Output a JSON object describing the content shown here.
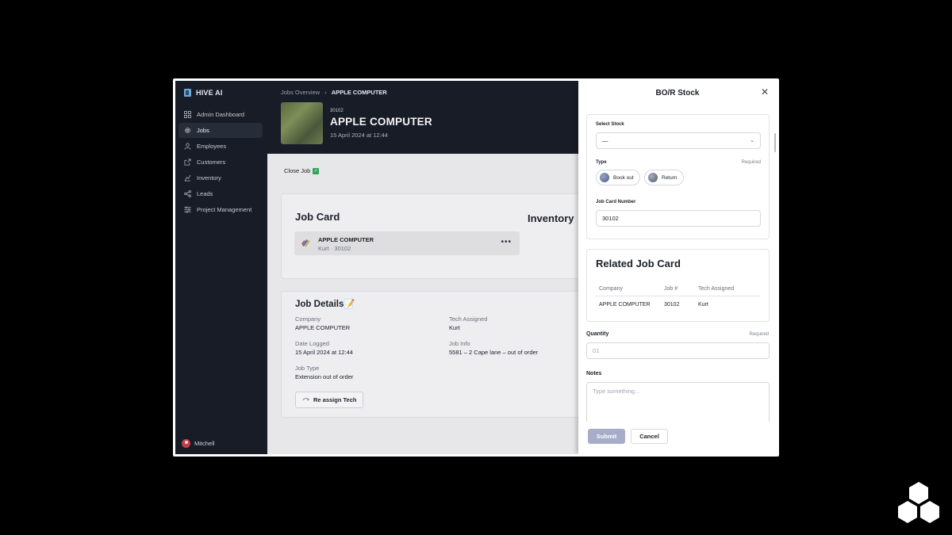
{
  "sidebar": {
    "brand": "HIVE AI",
    "items": [
      {
        "label": "Admin Dashboard",
        "icon": "grid-icon",
        "active": false
      },
      {
        "label": "Jobs",
        "icon": "gear-icon",
        "active": true
      },
      {
        "label": "Employees",
        "icon": "person-icon",
        "active": false
      },
      {
        "label": "Customers",
        "icon": "share-icon",
        "active": false
      },
      {
        "label": "Inventory",
        "icon": "chart-icon",
        "active": false
      },
      {
        "label": "Leads",
        "icon": "nodes-icon",
        "active": false
      },
      {
        "label": "Project Management",
        "icon": "sliders-icon",
        "active": false
      }
    ],
    "user": "Mitchell"
  },
  "header": {
    "breadcrumb_parent": "Jobs Overview",
    "breadcrumb_sep": "›",
    "breadcrumb_current": "APPLE COMPUTER",
    "job_number": "30102",
    "job_title": "APPLE COMPUTER",
    "job_date": "15 April 2024 at 12:44"
  },
  "close_job": {
    "label": "Close Job",
    "check": "✓"
  },
  "job_card": {
    "heading": "Job Card",
    "inventory_heading": "Inventory",
    "company": "APPLE COMPUTER",
    "subtitle": "Kurt · 30102",
    "more": "•••"
  },
  "job_details": {
    "heading": "Job Details📝",
    "company_label": "Company",
    "company_value": "APPLE COMPUTER",
    "tech_label": "Tech Assigned",
    "tech_value": "Kurt",
    "date_label": "Date Logged",
    "date_value": "15 April 2024 at 12:44",
    "info_label": "Job Info",
    "info_value": "5581 – 2 Cape lane – out of order",
    "type_label": "Job Type",
    "type_value": "Extension out of order",
    "reassign_label": "Re assign Tech"
  },
  "modal": {
    "title": "BO/R Stock",
    "close": "✕",
    "select_stock_label": "Select Stock",
    "select_stock_value": "—",
    "select_chevron": "⌄",
    "type_label": "Type",
    "required": "Required",
    "type_options": [
      "Book out",
      "Return"
    ],
    "job_card_number_label": "Job Card Number",
    "job_card_number_value": "30102",
    "related_heading": "Related Job Card",
    "table_headers": [
      "Company",
      "Job #",
      "Tech Assigned"
    ],
    "table_row": [
      "APPLE COMPUTER",
      "30102",
      "Kurt"
    ],
    "quantity_label": "Quantity",
    "quantity_placeholder": "01",
    "notes_label": "Notes",
    "notes_placeholder": "Type something...",
    "submit": "Submit",
    "cancel": "Cancel"
  },
  "colors": {
    "sidebar_bg": "#181c27",
    "submit_bg": "#a7acc9",
    "check_green": "#35a35a"
  }
}
